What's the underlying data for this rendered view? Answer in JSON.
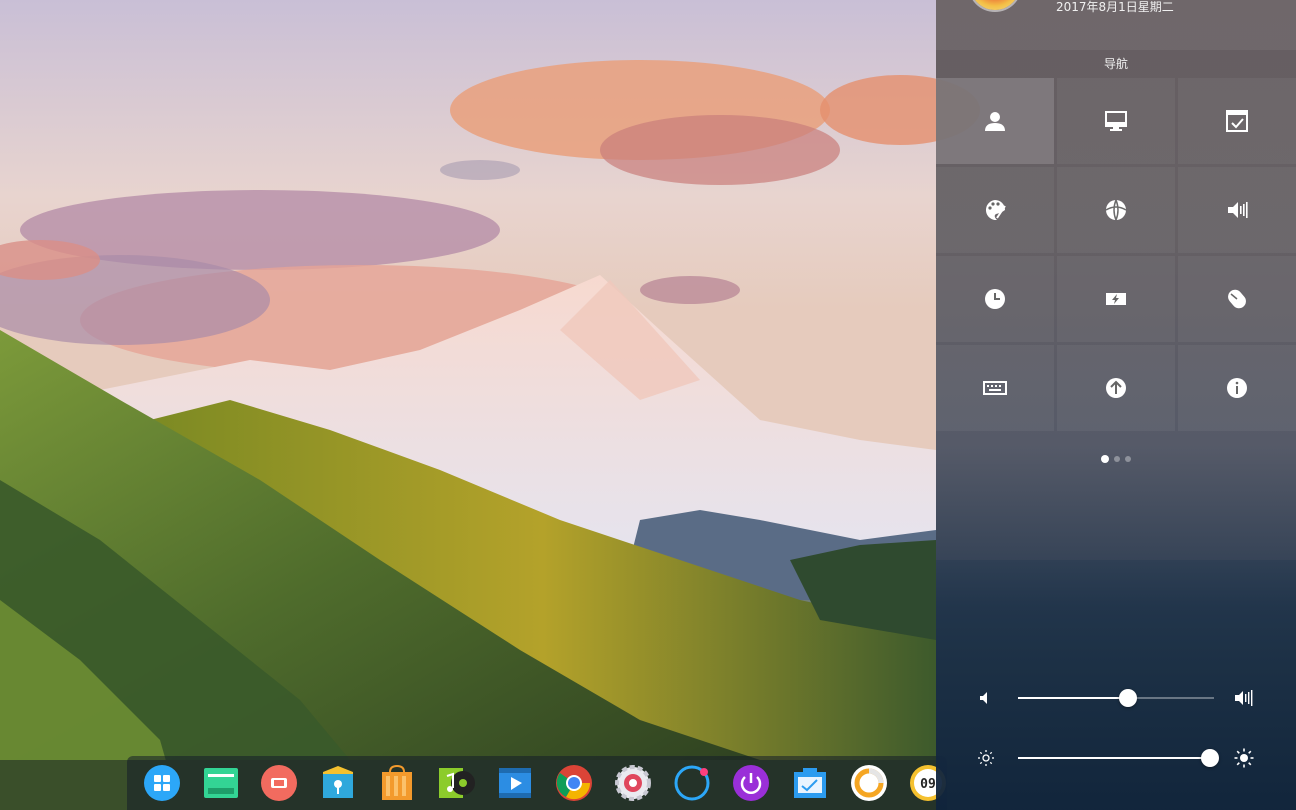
{
  "panel": {
    "date": "2017年8月1日星期二",
    "nav_title": "导航",
    "tiles": [
      {
        "icon": "account-icon",
        "active": true
      },
      {
        "icon": "display-icon"
      },
      {
        "icon": "default-apps-icon"
      },
      {
        "icon": "personalization-icon"
      },
      {
        "icon": "network-icon"
      },
      {
        "icon": "sound-icon"
      },
      {
        "icon": "time-icon"
      },
      {
        "icon": "power-icon"
      },
      {
        "icon": "mouse-icon"
      },
      {
        "icon": "keyboard-icon"
      },
      {
        "icon": "update-icon"
      },
      {
        "icon": "system-info-icon"
      }
    ],
    "page_count": 3,
    "current_page": 1,
    "volume": 0.56,
    "brightness": 0.98
  },
  "dock": {
    "items": [
      "launcher-icon",
      "deepin-store-icon",
      "deepin-screenshot-icon",
      "file-manager-icon",
      "app-store-icon",
      "music-icon",
      "movie-icon",
      "chrome-icon",
      "settings-icon",
      "deepin-loader-icon",
      "shutdown-icon",
      "system-monitor-icon",
      "browser-icon",
      "clock-icon"
    ],
    "clock_text": "09"
  },
  "colors": {
    "accent": "#2ca7f8"
  }
}
